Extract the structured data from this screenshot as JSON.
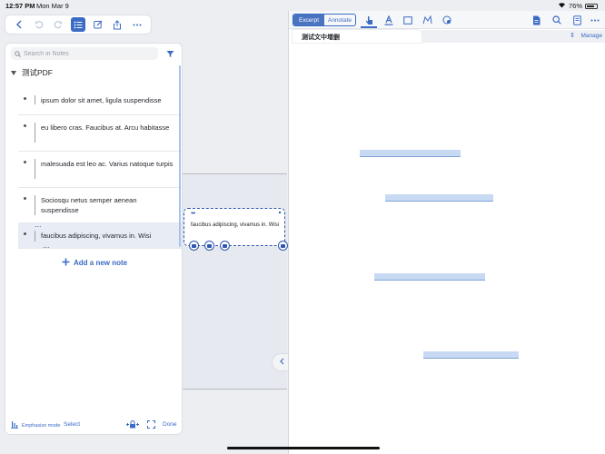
{
  "status_bar": {
    "time": "12:57 PM",
    "date": "Mon Mar 9",
    "battery": "76%"
  },
  "left_toolbar": {
    "icons": [
      "chevron-left-icon",
      "undo-icon",
      "redo-icon",
      "list-icon",
      "edit-icon",
      "share-icon",
      "more-icon"
    ]
  },
  "notes": {
    "search_placeholder": "Search in Notes",
    "document_title": "测试PDF",
    "items": [
      {
        "text": "ipsum dolor sit amet, ligula suspendisse"
      },
      {
        "text": "eu libero cras. Faucibus at. Arcu habitasse"
      },
      {
        "text": "malesuada est leo ac. Varius natoque turpis"
      },
      {
        "text": "Sociosqu netus semper aenean suspendisse"
      },
      {
        "text": "faucibus adipiscing, vivamus in. Wisi"
      }
    ],
    "add_note_label": "Add a new note",
    "bottom": {
      "emphasize_label": "Emphasize mode",
      "select_label": "Select",
      "done_label": "Done"
    }
  },
  "card": {
    "text": "faucibus adipiscing, vivamus in. Wisi"
  },
  "right_pane": {
    "segments": {
      "excerpt": "Excerpt",
      "annotate": "Annotate",
      "selected": "Excerpt"
    },
    "doc_tab": "测试文中增删",
    "manage_label": "Manage"
  },
  "colors": {
    "accent": "#3a6bc5",
    "highlight": "#c8daf3"
  }
}
